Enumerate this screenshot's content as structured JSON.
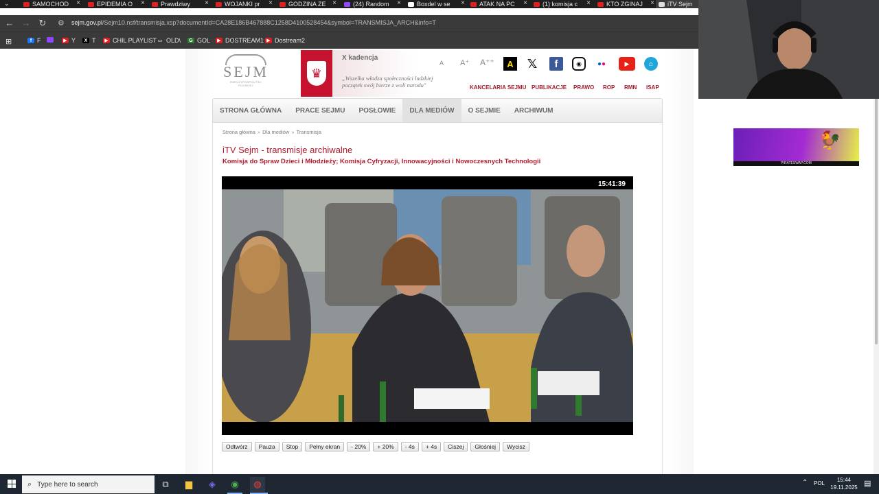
{
  "browser": {
    "tabs": [
      {
        "label": "SAMOCHOD",
        "fav": "#e02020"
      },
      {
        "label": "EPIDEMIA O",
        "fav": "#e02020"
      },
      {
        "label": "Prawdziwy",
        "fav": "#e02020"
      },
      {
        "label": "WOJANKI pr",
        "fav": "#e02020"
      },
      {
        "label": "GODZINA ZE",
        "fav": "#e02020"
      },
      {
        "label": "(24) Random",
        "fav": "#9146ff"
      },
      {
        "label": "Boxdel w se",
        "fav": "#ffffff"
      },
      {
        "label": "ATAK NA PC",
        "fav": "#e02020"
      },
      {
        "label": "(1) komisja c",
        "fav": "#e02020"
      },
      {
        "label": "KTO ZGINAJ",
        "fav": "#e02020"
      },
      {
        "label": "iTV Sejm",
        "fav": "#dddddd"
      }
    ],
    "url_domain": "sejm.gov.pl",
    "url_path": "/Sejm10.nsf/transmisja.xsp?documentId=CA28E186B467888C1258D4100528454&symbol=TRANSMISJA_ARCH&info=T",
    "bookmarks": [
      {
        "label": "F",
        "fav": "#1877f2",
        "glyph": "f"
      },
      {
        "label": "",
        "fav": "#9146ff",
        "glyph": ""
      },
      {
        "label": "Y",
        "fav": "#e02020",
        "glyph": "▶"
      },
      {
        "label": "T",
        "fav": "#000000",
        "glyph": "X"
      },
      {
        "label": "CHIL PLAYLIST",
        "fav": "#e02020",
        "glyph": "▶"
      },
      {
        "label": "OLD\\",
        "fav": "transparent",
        "glyph": "▭"
      },
      {
        "label": "GOL",
        "fav": "#2e7d32",
        "glyph": "G"
      },
      {
        "label": "DOSTREAM1",
        "fav": "#e02020",
        "glyph": "▶"
      },
      {
        "label": "Dostream2",
        "fav": "#e02020",
        "glyph": "▶"
      }
    ]
  },
  "site": {
    "logo_text": "SEJM",
    "logo_sub": "RZECZYPOSPOLITEJ POLSKIEJ",
    "kadencja": "X kadencja",
    "motto": "„Wszelka władza społeczności ludzkiej początek swój bierze z woli narodu\"",
    "font_small": "A",
    "font_medium": "A⁺",
    "font_large": "A⁺⁺",
    "contrast_label": "A",
    "top_links": [
      "KANCELARIA SEJMU",
      "PUBLIKACJE",
      "PRAWO",
      "ROP",
      "RMN",
      "ISAP"
    ],
    "menu": [
      "STRONA GŁÓWNA",
      "PRACE SEJMU",
      "POSŁOWIE",
      "DLA MEDIÓW",
      "O SEJMIE",
      "ARCHIWUM"
    ],
    "menu_active_index": 3
  },
  "breadcrumb": {
    "home": "Strona główna",
    "section": "Dla mediów",
    "current": "Transmisja",
    "separator": "»"
  },
  "title": "iTV Sejm - transmisje archiwalne",
  "subtitle": "Komisja do Spraw Dzieci i Młodzieży; Komisja Cyfryzacji, Innowacyjności i Nowoczesnych Technologii",
  "player": {
    "timestamp": "15:41:39",
    "controls": [
      "Odtwórz",
      "Pauza",
      "Stop",
      "Pełny ekran",
      "- 20%",
      "+ 20%",
      "- 4s",
      "+ 4s",
      "Ciszej",
      "Głośniej",
      "Wycisz"
    ]
  },
  "ad": {
    "footer": "PIRATESWAP.COM"
  },
  "taskbar": {
    "search_placeholder": "Type here to search",
    "language": "POL",
    "time": "15:44",
    "date": "19.11.2025"
  },
  "colors": {
    "accent_red": "#b01a2c",
    "tabbar": "#1f1f1f",
    "toolbar": "#3a3a3a",
    "taskbar": "#1f2733"
  }
}
